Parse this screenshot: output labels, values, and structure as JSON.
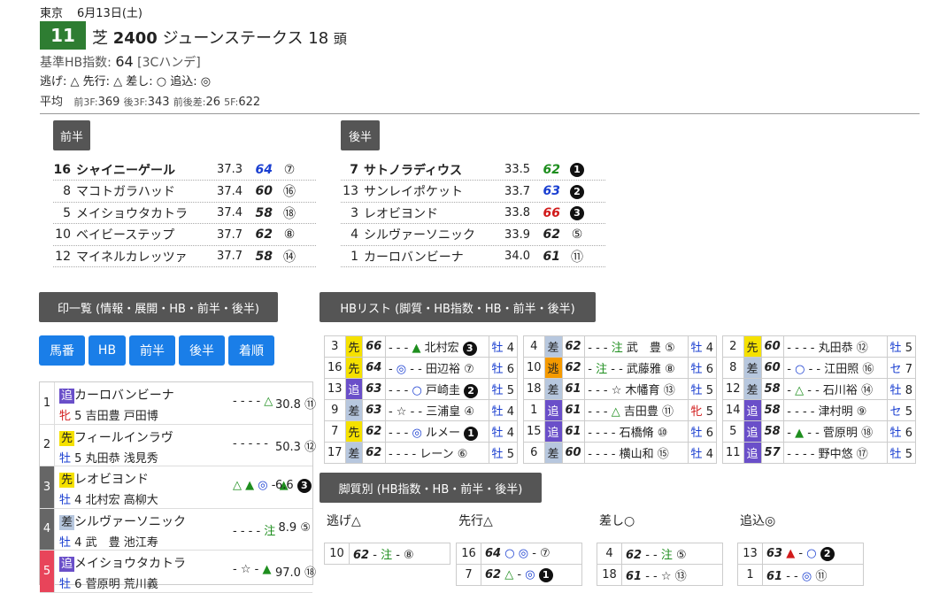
{
  "header": {
    "venue": "東京",
    "date": "6月13日(土)",
    "race_no": "11",
    "surface": "芝",
    "distance": "2400",
    "name": "ジューンステークス",
    "heads": "18",
    "heads_unit": "頭",
    "hb_label": "基準HB指数:",
    "hb_value": "64",
    "hb_note": "[3Cハンデ]",
    "legs_line": "逃げ: △ 先行: △ 差し: ○ 追込: ◎",
    "avg_label": "平均",
    "avg_items": [
      {
        "k": "前3F:",
        "v": "369"
      },
      {
        "k": "後3F:",
        "v": "343"
      },
      {
        "k": "前後差:",
        "v": "26"
      },
      {
        "k": "5F:",
        "v": "622"
      }
    ]
  },
  "zenhan": {
    "label": "前半",
    "rows": [
      {
        "no": "16",
        "name": "シャイニーゲール",
        "time": "37.3",
        "hb": "64",
        "mark": "⑦",
        "bold": true,
        "hbcolor": "blue"
      },
      {
        "no": "8",
        "name": "マコトガラハッド",
        "time": "37.4",
        "hb": "60",
        "mark": "⑯",
        "hbcolor": ""
      },
      {
        "no": "5",
        "name": "メイショウタカトラ",
        "time": "37.4",
        "hb": "58",
        "mark": "⑱",
        "hbcolor": ""
      },
      {
        "no": "10",
        "name": "ベイビーステップ",
        "time": "37.7",
        "hb": "62",
        "mark": "⑧",
        "hbcolor": ""
      },
      {
        "no": "12",
        "name": "マイネルカレッツァ",
        "time": "37.7",
        "hb": "58",
        "mark": "⑭",
        "hbcolor": ""
      }
    ]
  },
  "kohan": {
    "label": "後半",
    "rows": [
      {
        "no": "7",
        "name": "サトノラディウス",
        "time": "33.5",
        "hb": "62",
        "mark": "1",
        "bold": true,
        "hbcolor": "green"
      },
      {
        "no": "13",
        "name": "サンレイポケット",
        "time": "33.7",
        "hb": "63",
        "mark": "2",
        "hbcolor": "blue"
      },
      {
        "no": "3",
        "name": "レオビヨンド",
        "time": "33.8",
        "hb": "66",
        "mark": "3",
        "hbcolor": "red"
      },
      {
        "no": "4",
        "name": "シルヴァーソニック",
        "time": "33.9",
        "hb": "62",
        "mark": "⑤",
        "hbcolor": ""
      },
      {
        "no": "1",
        "name": "カーロバンビーナ",
        "time": "34.0",
        "hb": "61",
        "mark": "⑪",
        "hbcolor": ""
      }
    ]
  },
  "shirushi": {
    "label": "印一覧 (情報・展開・HB・前半・後半)",
    "tabs": [
      "馬番",
      "HB",
      "前半",
      "後半",
      "着順"
    ],
    "rows": [
      {
        "idx": "1",
        "leg": "追",
        "name": "カーロバンビーナ",
        "sex": "牝",
        "age": "5",
        "jockey": "吉田豊",
        "trainer": "戸田博",
        "marks": "- - - - △",
        "odds": "30.8",
        "rank": "⑪",
        "idxstyle": ""
      },
      {
        "idx": "2",
        "leg": "先",
        "name": "フィールインラヴ",
        "sex": "牡",
        "age": "5",
        "jockey": "丸田恭",
        "trainer": "浅見秀",
        "marks": "- - - - -",
        "odds": "50.3",
        "rank": "⑫",
        "idxstyle": ""
      },
      {
        "idx": "3",
        "leg": "先",
        "name": "レオビヨンド",
        "sex": "牡",
        "age": "4",
        "jockey": "北村宏",
        "trainer": "高柳大",
        "marks": "△ ▲ ◎ - ▲",
        "odds": "6.6",
        "rank": "3",
        "idxstyle": "gray"
      },
      {
        "idx": "4",
        "leg": "差",
        "name": "シルヴァーソニック",
        "sex": "牡",
        "age": "4",
        "jockey": "武　豊",
        "trainer": "池江寿",
        "marks": "- - - - 注",
        "odds": "8.9",
        "rank": "⑤",
        "idxstyle": "gray"
      },
      {
        "idx": "5",
        "leg": "追",
        "name": "メイショウタカトラ",
        "sex": "牡",
        "age": "6",
        "jockey": "菅原明",
        "trainer": "荒川義",
        "marks": "- ☆ - ▲",
        "odds": "97.0",
        "rank": "⑱",
        "idxstyle": "pink"
      }
    ]
  },
  "hblist": {
    "label": "HBリスト (脚質・HB指数・HB・前半・後半)",
    "cols": [
      [
        {
          "no": "3",
          "leg": "先",
          "hb": "66",
          "m1": "-",
          "m2": "▲",
          "jockey": "北村宏",
          "rk": "3",
          "sex": "牡",
          "age": "4"
        },
        {
          "no": "16",
          "leg": "先",
          "hb": "64",
          "m1": "◎",
          "m2": "-",
          "jockey": "田辺裕",
          "rk": "⑦",
          "sex": "牡",
          "age": "6"
        },
        {
          "no": "13",
          "leg": "追",
          "hb": "63",
          "m1": "-",
          "m2": "○",
          "jockey": "戸崎圭",
          "rk": "2",
          "sex": "牡",
          "age": "5"
        },
        {
          "no": "9",
          "leg": "差",
          "hb": "63",
          "m1": "☆",
          "m2": "-",
          "jockey": "三浦皇",
          "rk": "④",
          "sex": "牡",
          "age": "4"
        },
        {
          "no": "7",
          "leg": "先",
          "hb": "62",
          "m1": "-",
          "m2": "◎",
          "jockey": "ルメー",
          "rk": "1",
          "sex": "牡",
          "age": "4"
        },
        {
          "no": "17",
          "leg": "差",
          "hb": "62",
          "m1": "-",
          "m2": "-",
          "jockey": "レーン",
          "rk": "⑥",
          "sex": "牡",
          "age": "5"
        }
      ],
      [
        {
          "no": "4",
          "leg": "差",
          "hb": "62",
          "m1": "-",
          "m2": "注",
          "jockey": "武　豊",
          "rk": "⑤",
          "sex": "牡",
          "age": "4"
        },
        {
          "no": "10",
          "leg": "逃",
          "hb": "62",
          "m1": "注",
          "m2": "-",
          "jockey": "武藤雅",
          "rk": "⑧",
          "sex": "牡",
          "age": "6"
        },
        {
          "no": "18",
          "leg": "差",
          "hb": "61",
          "m1": "-",
          "m2": "☆",
          "jockey": "木幡育",
          "rk": "⑬",
          "sex": "牡",
          "age": "5"
        },
        {
          "no": "1",
          "leg": "追",
          "hb": "61",
          "m1": "-",
          "m2": "△",
          "jockey": "吉田豊",
          "rk": "⑪",
          "sex": "牝",
          "age": "5"
        },
        {
          "no": "15",
          "leg": "追",
          "hb": "61",
          "m1": "-",
          "m2": "-",
          "jockey": "石橋脩",
          "rk": "⑩",
          "sex": "牡",
          "age": "6"
        },
        {
          "no": "6",
          "leg": "差",
          "hb": "60",
          "m1": "-",
          "m2": "-",
          "jockey": "横山和",
          "rk": "⑮",
          "sex": "牡",
          "age": "4"
        }
      ],
      [
        {
          "no": "2",
          "leg": "先",
          "hb": "60",
          "m1": "-",
          "m2": "-",
          "jockey": "丸田恭",
          "rk": "⑫",
          "sex": "牡",
          "age": "5"
        },
        {
          "no": "8",
          "leg": "差",
          "hb": "60",
          "m1": "○",
          "m2": "-",
          "jockey": "江田照",
          "rk": "⑯",
          "sex": "セ",
          "age": "7"
        },
        {
          "no": "12",
          "leg": "差",
          "hb": "58",
          "m1": "△",
          "m2": "-",
          "jockey": "石川裕",
          "rk": "⑭",
          "sex": "牡",
          "age": "8"
        },
        {
          "no": "14",
          "leg": "追",
          "hb": "58",
          "m1": "-",
          "m2": "-",
          "jockey": "津村明",
          "rk": "⑨",
          "sex": "セ",
          "age": "5"
        },
        {
          "no": "5",
          "leg": "追",
          "hb": "58",
          "m1": "▲",
          "m2": "-",
          "jockey": "菅原明",
          "rk": "⑱",
          "sex": "牡",
          "age": "6"
        },
        {
          "no": "11",
          "leg": "追",
          "hb": "57",
          "m1": "-",
          "m2": "-",
          "jockey": "野中悠",
          "rk": "⑰",
          "sex": "牡",
          "age": "5"
        }
      ]
    ]
  },
  "kyakushitsu": {
    "label": "脚質別 (HB指数・HB・前半・後半)",
    "groups": [
      {
        "title": "逃げ△",
        "rows": [
          {
            "no": "10",
            "hb": "62",
            "m": "- 注 -",
            "rk": "⑧"
          }
        ]
      },
      {
        "title": "先行△",
        "rows": [
          {
            "no": "16",
            "hb": "64",
            "m": "○ ◎ -",
            "rk": "⑦"
          },
          {
            "no": "7",
            "hb": "62",
            "m": "△ - ◎",
            "rk": "1"
          }
        ]
      },
      {
        "title": "差し○",
        "rows": [
          {
            "no": "4",
            "hb": "62",
            "m": "- - 注",
            "rk": "⑤"
          },
          {
            "no": "18",
            "hb": "61",
            "m": "- - ☆",
            "rk": "⑬"
          }
        ]
      },
      {
        "title": "追込◎",
        "rows": [
          {
            "no": "13",
            "hb": "63",
            "m": "▲ - ○",
            "rk": "2"
          },
          {
            "no": "1",
            "hb": "61",
            "m": "- - ◎",
            "rk": "⑪"
          }
        ]
      }
    ]
  }
}
